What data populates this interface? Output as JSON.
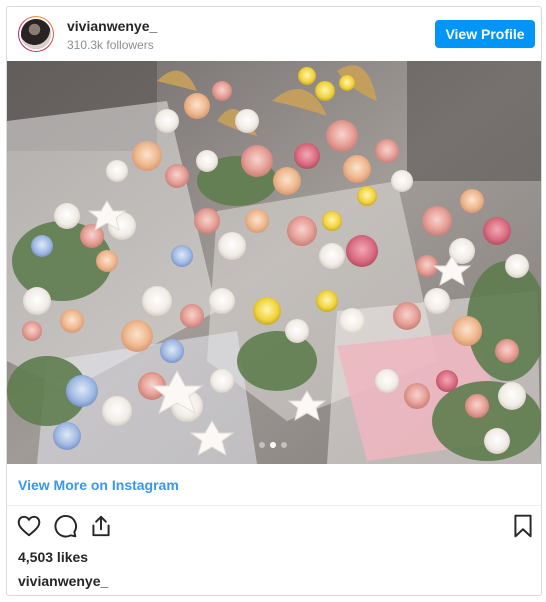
{
  "header": {
    "username": "vivianwenye_",
    "followers": "310.3k followers",
    "view_profile_label": "View Profile"
  },
  "media": {
    "carousel": {
      "total": 3,
      "active_index": 1
    }
  },
  "view_more_label": "View More on Instagram",
  "actions": {
    "icons": [
      "heart-icon",
      "comment-icon",
      "share-icon",
      "bookmark-icon"
    ]
  },
  "likes": "4,503 likes",
  "footer_username": "vivianwenye_",
  "colors": {
    "accent": "#0095f6",
    "link": "#3897f0",
    "text": "#262626",
    "muted": "#8e8e8e",
    "border": "#dbdbdb"
  }
}
